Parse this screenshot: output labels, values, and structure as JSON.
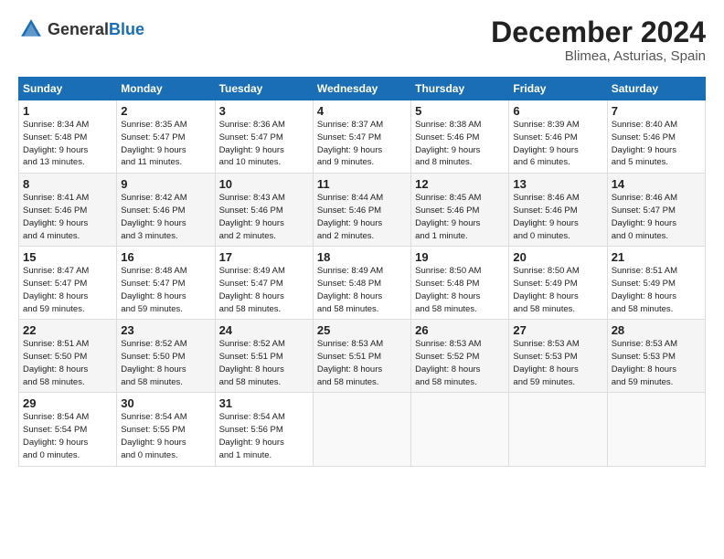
{
  "header": {
    "logo_general": "General",
    "logo_blue": "Blue",
    "title": "December 2024",
    "subtitle": "Blimea, Asturias, Spain"
  },
  "columns": [
    "Sunday",
    "Monday",
    "Tuesday",
    "Wednesday",
    "Thursday",
    "Friday",
    "Saturday"
  ],
  "weeks": [
    [
      {
        "day": "1",
        "lines": [
          "Sunrise: 8:34 AM",
          "Sunset: 5:48 PM",
          "Daylight: 9 hours",
          "and 13 minutes."
        ]
      },
      {
        "day": "2",
        "lines": [
          "Sunrise: 8:35 AM",
          "Sunset: 5:47 PM",
          "Daylight: 9 hours",
          "and 11 minutes."
        ]
      },
      {
        "day": "3",
        "lines": [
          "Sunrise: 8:36 AM",
          "Sunset: 5:47 PM",
          "Daylight: 9 hours",
          "and 10 minutes."
        ]
      },
      {
        "day": "4",
        "lines": [
          "Sunrise: 8:37 AM",
          "Sunset: 5:47 PM",
          "Daylight: 9 hours",
          "and 9 minutes."
        ]
      },
      {
        "day": "5",
        "lines": [
          "Sunrise: 8:38 AM",
          "Sunset: 5:46 PM",
          "Daylight: 9 hours",
          "and 8 minutes."
        ]
      },
      {
        "day": "6",
        "lines": [
          "Sunrise: 8:39 AM",
          "Sunset: 5:46 PM",
          "Daylight: 9 hours",
          "and 6 minutes."
        ]
      },
      {
        "day": "7",
        "lines": [
          "Sunrise: 8:40 AM",
          "Sunset: 5:46 PM",
          "Daylight: 9 hours",
          "and 5 minutes."
        ]
      }
    ],
    [
      {
        "day": "8",
        "lines": [
          "Sunrise: 8:41 AM",
          "Sunset: 5:46 PM",
          "Daylight: 9 hours",
          "and 4 minutes."
        ]
      },
      {
        "day": "9",
        "lines": [
          "Sunrise: 8:42 AM",
          "Sunset: 5:46 PM",
          "Daylight: 9 hours",
          "and 3 minutes."
        ]
      },
      {
        "day": "10",
        "lines": [
          "Sunrise: 8:43 AM",
          "Sunset: 5:46 PM",
          "Daylight: 9 hours",
          "and 2 minutes."
        ]
      },
      {
        "day": "11",
        "lines": [
          "Sunrise: 8:44 AM",
          "Sunset: 5:46 PM",
          "Daylight: 9 hours",
          "and 2 minutes."
        ]
      },
      {
        "day": "12",
        "lines": [
          "Sunrise: 8:45 AM",
          "Sunset: 5:46 PM",
          "Daylight: 9 hours",
          "and 1 minute."
        ]
      },
      {
        "day": "13",
        "lines": [
          "Sunrise: 8:46 AM",
          "Sunset: 5:46 PM",
          "Daylight: 9 hours",
          "and 0 minutes."
        ]
      },
      {
        "day": "14",
        "lines": [
          "Sunrise: 8:46 AM",
          "Sunset: 5:47 PM",
          "Daylight: 9 hours",
          "and 0 minutes."
        ]
      }
    ],
    [
      {
        "day": "15",
        "lines": [
          "Sunrise: 8:47 AM",
          "Sunset: 5:47 PM",
          "Daylight: 8 hours",
          "and 59 minutes."
        ]
      },
      {
        "day": "16",
        "lines": [
          "Sunrise: 8:48 AM",
          "Sunset: 5:47 PM",
          "Daylight: 8 hours",
          "and 59 minutes."
        ]
      },
      {
        "day": "17",
        "lines": [
          "Sunrise: 8:49 AM",
          "Sunset: 5:47 PM",
          "Daylight: 8 hours",
          "and 58 minutes."
        ]
      },
      {
        "day": "18",
        "lines": [
          "Sunrise: 8:49 AM",
          "Sunset: 5:48 PM",
          "Daylight: 8 hours",
          "and 58 minutes."
        ]
      },
      {
        "day": "19",
        "lines": [
          "Sunrise: 8:50 AM",
          "Sunset: 5:48 PM",
          "Daylight: 8 hours",
          "and 58 minutes."
        ]
      },
      {
        "day": "20",
        "lines": [
          "Sunrise: 8:50 AM",
          "Sunset: 5:49 PM",
          "Daylight: 8 hours",
          "and 58 minutes."
        ]
      },
      {
        "day": "21",
        "lines": [
          "Sunrise: 8:51 AM",
          "Sunset: 5:49 PM",
          "Daylight: 8 hours",
          "and 58 minutes."
        ]
      }
    ],
    [
      {
        "day": "22",
        "lines": [
          "Sunrise: 8:51 AM",
          "Sunset: 5:50 PM",
          "Daylight: 8 hours",
          "and 58 minutes."
        ]
      },
      {
        "day": "23",
        "lines": [
          "Sunrise: 8:52 AM",
          "Sunset: 5:50 PM",
          "Daylight: 8 hours",
          "and 58 minutes."
        ]
      },
      {
        "day": "24",
        "lines": [
          "Sunrise: 8:52 AM",
          "Sunset: 5:51 PM",
          "Daylight: 8 hours",
          "and 58 minutes."
        ]
      },
      {
        "day": "25",
        "lines": [
          "Sunrise: 8:53 AM",
          "Sunset: 5:51 PM",
          "Daylight: 8 hours",
          "and 58 minutes."
        ]
      },
      {
        "day": "26",
        "lines": [
          "Sunrise: 8:53 AM",
          "Sunset: 5:52 PM",
          "Daylight: 8 hours",
          "and 58 minutes."
        ]
      },
      {
        "day": "27",
        "lines": [
          "Sunrise: 8:53 AM",
          "Sunset: 5:53 PM",
          "Daylight: 8 hours",
          "and 59 minutes."
        ]
      },
      {
        "day": "28",
        "lines": [
          "Sunrise: 8:53 AM",
          "Sunset: 5:53 PM",
          "Daylight: 8 hours",
          "and 59 minutes."
        ]
      }
    ],
    [
      {
        "day": "29",
        "lines": [
          "Sunrise: 8:54 AM",
          "Sunset: 5:54 PM",
          "Daylight: 9 hours",
          "and 0 minutes."
        ]
      },
      {
        "day": "30",
        "lines": [
          "Sunrise: 8:54 AM",
          "Sunset: 5:55 PM",
          "Daylight: 9 hours",
          "and 0 minutes."
        ]
      },
      {
        "day": "31",
        "lines": [
          "Sunrise: 8:54 AM",
          "Sunset: 5:56 PM",
          "Daylight: 9 hours",
          "and 1 minute."
        ]
      },
      null,
      null,
      null,
      null
    ]
  ]
}
